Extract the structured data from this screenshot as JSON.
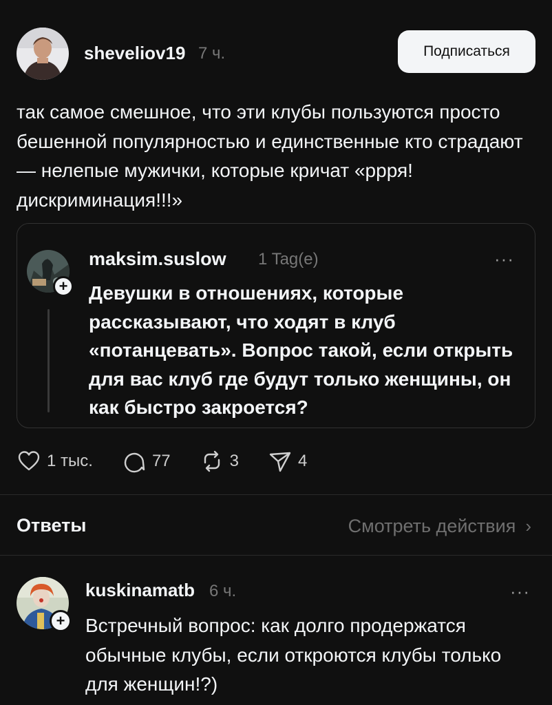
{
  "post": {
    "author": "sheveliov19",
    "time": "7 ч.",
    "follow_label": "Подписаться",
    "text": "так самое смешное, что эти клубы пользуются просто бешенной популярностью и единственные кто страдают — нелепые мужички, которые кричат «ррря! дискриминация!!!»"
  },
  "quoted": {
    "author": "maksim.suslow",
    "time": "1 Tag(e)",
    "more": "···",
    "text": "Девушки в отношениях, которые рассказывают, что ходят в клуб «потанцевать». Вопрос такой, если открыть для вас клуб где будут только женщины, он как быстро закроется?",
    "follow_badge": "+"
  },
  "actions": {
    "likes": "1 тыс.",
    "comments": "77",
    "reposts": "3",
    "shares": "4"
  },
  "replies_section": {
    "title": "Ответы",
    "view_activity": "Смотреть действия",
    "chevron": "›"
  },
  "reply": {
    "author": "kuskinamatb",
    "time": "6 ч.",
    "more": "···",
    "follow_badge": "+",
    "text": "Встречный вопрос: как долго продержатся обычные клубы, если откроются клубы только для женщин!?)"
  },
  "icons": {
    "like": "heart-icon",
    "comment": "comment-icon",
    "repost": "repost-icon",
    "share": "send-icon",
    "more": "more-icon",
    "chevron": "chevron-right-icon"
  },
  "colors": {
    "background": "#101010",
    "text": "#f3f5f7",
    "muted": "#777777",
    "button_bg": "#f3f5f7"
  }
}
